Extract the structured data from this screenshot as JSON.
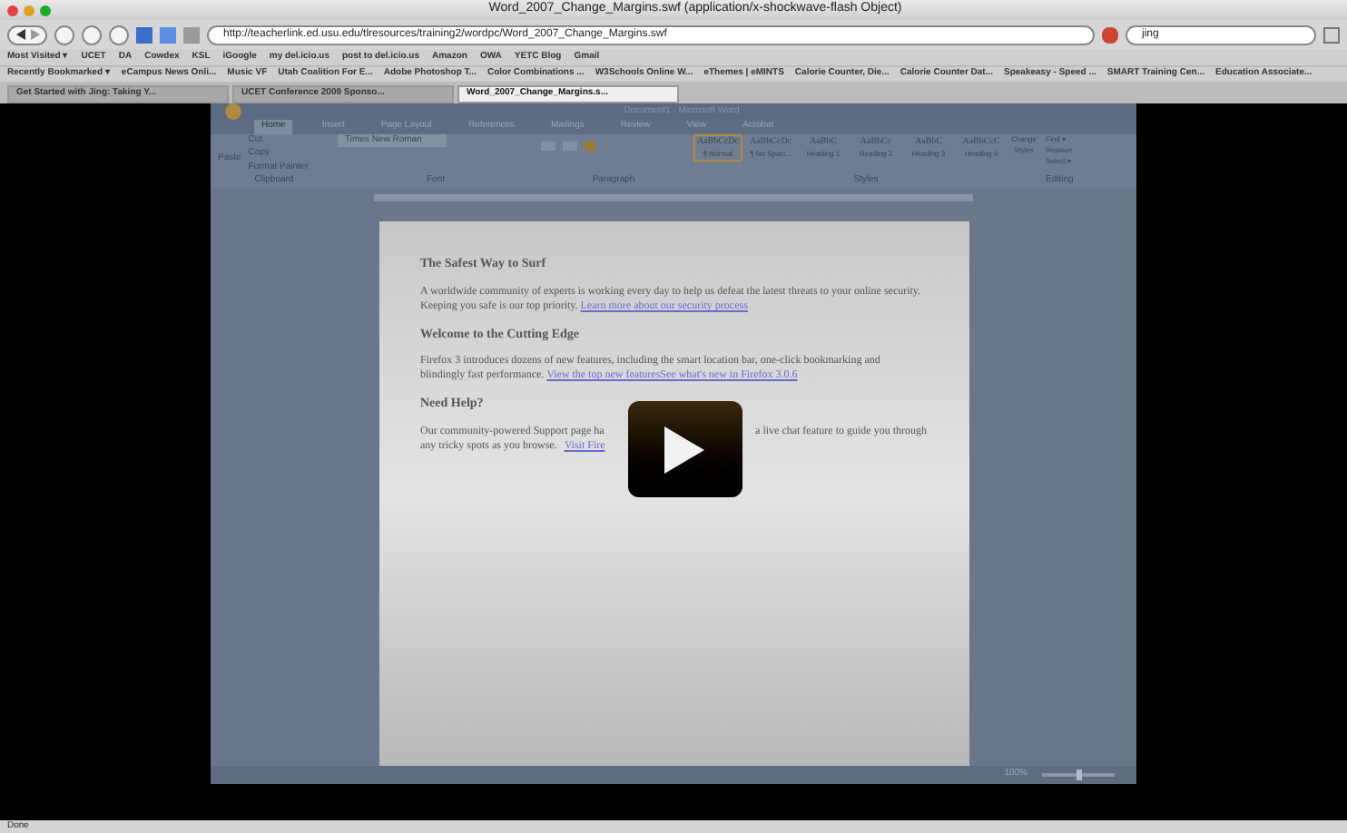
{
  "window": {
    "title": "Word_2007_Change_Margins.swf (application/x-shockwave-flash Object)"
  },
  "toolbar": {
    "url": "http://teacherlink.ed.usu.edu/tlresources/training2/wordpc/Word_2007_Change_Margins.swf",
    "search": "jing"
  },
  "bookmarks_bar": [
    "Most Visited ▾",
    "UCET",
    "DA",
    "Cowdex",
    "KSL",
    "iGoogle",
    "my del.icio.us",
    "post to del.icio.us",
    "Amazon",
    "OWA",
    "YETC Blog",
    "Gmail"
  ],
  "bookmarks_bar_2": [
    "Recently Bookmarked ▾",
    "eCampus News Onli...",
    "Music VF",
    "Utah Coalition For E...",
    "Adobe Photoshop T...",
    "Color Combinations ...",
    "W3Schools Online W...",
    "eThemes | eMINTS",
    "Calorie Counter, Die...",
    "Calorie Counter Dat...",
    "Speakeasy - Speed ...",
    "SMART Training Cen...",
    "Education Associate..."
  ],
  "tabs": [
    {
      "label": "Get Started with Jing: Taking Y...",
      "selected": false
    },
    {
      "label": "UCET Conference 2009 Sponso...",
      "selected": false
    },
    {
      "label": "Word_2007_Change_Margins.s...",
      "selected": true
    }
  ],
  "video": {
    "word_title": "Document1 - Microsoft Word",
    "ribbon_tabs": [
      {
        "label": "Home",
        "selected": true
      },
      {
        "label": "Insert",
        "selected": false
      },
      {
        "label": "Page Layout",
        "selected": false
      },
      {
        "label": "References",
        "selected": false
      },
      {
        "label": "Mailings",
        "selected": false
      },
      {
        "label": "Review",
        "selected": false
      },
      {
        "label": "View",
        "selected": false
      },
      {
        "label": "Acrobat",
        "selected": false
      }
    ],
    "paste": "Paste",
    "clipboard": [
      "Cut",
      "Copy",
      "Format Painter"
    ],
    "font": "Times New Roman",
    "styles": [
      {
        "sample": "AaBbCcDc",
        "name": "¶ Normal",
        "selected": true
      },
      {
        "sample": "AaBbCcDc",
        "name": "¶ No Spaci...",
        "selected": false
      },
      {
        "sample": "AaBbC",
        "name": "Heading 1",
        "selected": false
      },
      {
        "sample": "AaBbCc",
        "name": "Heading 2",
        "selected": false
      },
      {
        "sample": "AaBbC",
        "name": "Heading 3",
        "selected": false
      },
      {
        "sample": "AaBbCcC",
        "name": "Heading 4",
        "selected": false
      }
    ],
    "change_styles": "Change Styles",
    "editing": [
      "Find ▾",
      "Replace",
      "Select ▾"
    ],
    "groups": [
      "Clipboard",
      "Font",
      "Paragraph",
      "Styles",
      "Editing"
    ],
    "sections": [
      {
        "heading": "The Safest Way to Surf",
        "body": "A worldwide community of experts is working every day to help us defeat the latest threats to your online security. Keeping you safe is our top priority.",
        "link": "Learn more about our security process"
      },
      {
        "heading": "Welcome to the Cutting Edge",
        "body": "Firefox 3 introduces dozens of new features, including the smart location bar, one-click bookmarking and blindingly fast performance.",
        "link": "View the top new featuresSee what's new in Firefox 3.0.6"
      },
      {
        "heading": "Need Help?",
        "body_left": "Our community-powered Support page ha",
        "body_right": "a live chat feature to guide you through",
        "body_line2": "any tricky spots as you browse.",
        "link": "Visit Fire"
      }
    ],
    "zoom": "100%",
    "zoom_slider": {
      "level": 0.5
    }
  },
  "status_bar": "Done"
}
